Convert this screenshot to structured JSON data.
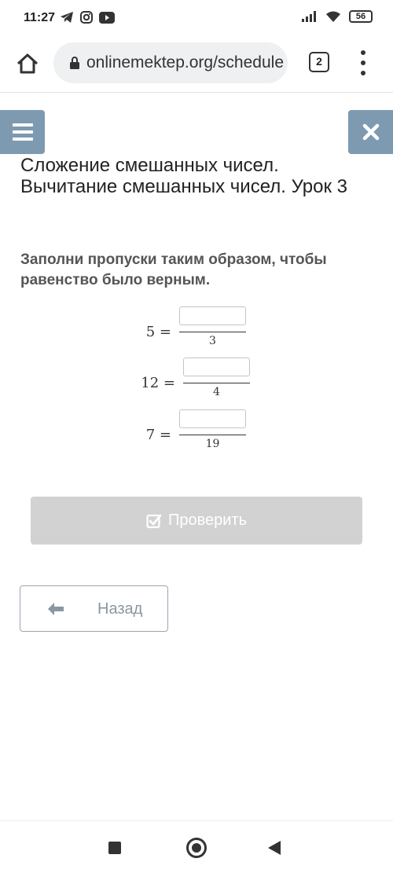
{
  "status_bar": {
    "time": "11:27",
    "battery": "56",
    "icons": [
      "telegram-icon",
      "instagram-icon",
      "youtube-icon",
      "signal-icon",
      "wifi-icon",
      "battery-icon"
    ]
  },
  "browser": {
    "url": "onlinemektep.org/schedule",
    "tab_count": "2"
  },
  "page": {
    "title": "Сложение смешанных чисел. Вычитание смешанных чисел. Урок 3",
    "instruction": "Заполни пропуски таким образом, чтобы равенство было верным.",
    "equations": [
      {
        "left": "5 =",
        "numerator": "",
        "denominator": "3"
      },
      {
        "left": "12 =",
        "numerator": "",
        "denominator": "4"
      },
      {
        "left": "7 =",
        "numerator": "",
        "denominator": "19"
      }
    ],
    "check_label": "Проверить",
    "back_label": "Назад"
  },
  "colors": {
    "menu_button": "#7d9ab1",
    "check_button_disabled": "#d2d2d2",
    "back_border": "#9aa5b1"
  }
}
